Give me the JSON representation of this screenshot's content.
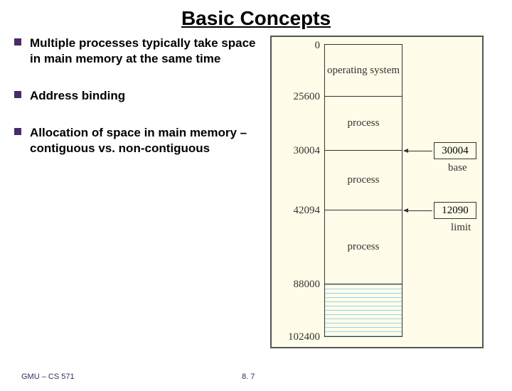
{
  "title": "Basic Concepts",
  "bullets": [
    "Multiple processes typically take space in main memory at the same time",
    "Address binding",
    "Allocation of space in main memory – contiguous vs. non-contiguous"
  ],
  "memory": {
    "addresses": [
      "0",
      "25600",
      "30004",
      "42094",
      "88000",
      "102400"
    ],
    "blocks": [
      "operating system",
      "process",
      "process",
      "process",
      ""
    ],
    "base_box": "30004",
    "base_label": "base",
    "limit_box": "12090",
    "limit_label": "limit"
  },
  "footer": {
    "left": "GMU – CS 571",
    "center": "8. 7"
  }
}
